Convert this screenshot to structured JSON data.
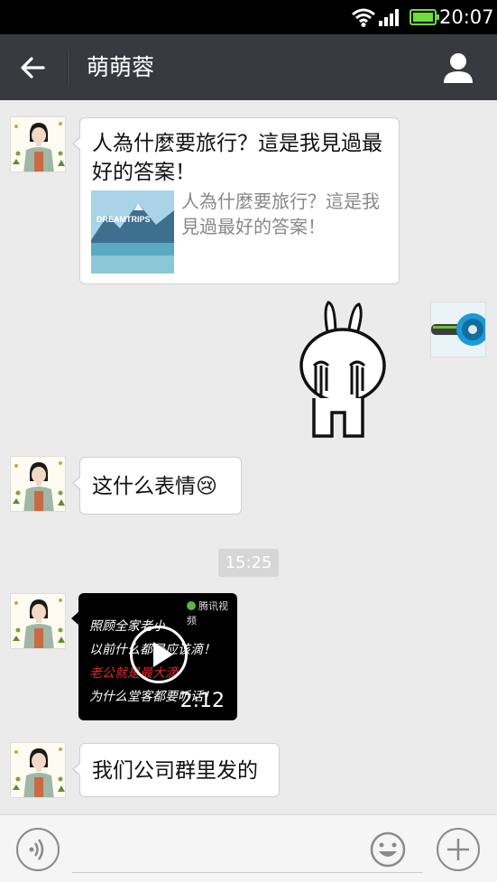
{
  "status_bar": {
    "time": "20:07"
  },
  "header": {
    "title": "萌萌蓉"
  },
  "messages": [
    {
      "type": "link",
      "title": "人為什麼要旅行？這是我見過最好的答案！",
      "description": "人為什麼要旅行？這是我見過最好的答案！",
      "thumbnail_text": "DREAMTRIPS"
    },
    {
      "type": "sticker",
      "direction": "outgoing"
    },
    {
      "type": "text",
      "text": "这什么表情😢"
    },
    {
      "type": "timestamp",
      "text": "15:25"
    },
    {
      "type": "video",
      "lines": [
        "照顾全家老小",
        "以前什么都是应该滴！",
        "老公就是最大滴",
        "为什么堂客都要听话！"
      ],
      "duration": "2:12",
      "source": "腾讯视频"
    },
    {
      "type": "text",
      "text": "我们公司群里发的"
    }
  ],
  "colors": {
    "header_bg": "#393a3f",
    "chat_bg": "#ebebeb",
    "battery": "#6fdc3a"
  }
}
